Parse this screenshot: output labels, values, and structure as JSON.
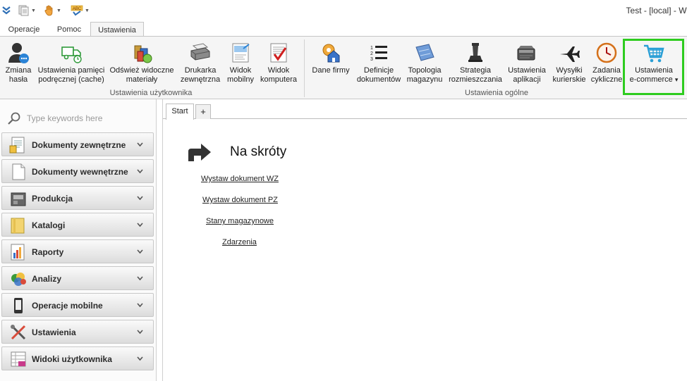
{
  "window": {
    "title": "Test - [local] - We"
  },
  "quick_access": [
    {
      "icon": "double-chevron-down-icon"
    },
    {
      "icon": "document-stack-icon"
    },
    {
      "icon": "hand-icon"
    },
    {
      "icon": "spellcheck-icon",
      "text": "ABC"
    }
  ],
  "tabs": [
    {
      "label": "Operacje"
    },
    {
      "label": "Pomoc"
    },
    {
      "label": "Ustawienia",
      "active": true
    }
  ],
  "ribbon": {
    "groups": [
      {
        "label": "Ustawienia użytkownika"
      },
      {
        "label": "Ustawienia ogólne"
      }
    ],
    "buttons": [
      {
        "label": "Zmiana\nhasła",
        "icon": "user-password-icon"
      },
      {
        "label": "Ustawienia pamięci\npodręcznej (cache)",
        "icon": "cache-truck-icon"
      },
      {
        "label": "Odśwież widoczne\nmateriały",
        "icon": "refresh-materials-icon"
      },
      {
        "label": "Drukarka\nzewnętrzna",
        "icon": "printer-icon"
      },
      {
        "label": "Widok\nmobilny",
        "icon": "mobile-view-icon"
      },
      {
        "label": "Widok\nkomputera",
        "icon": "computer-view-icon"
      },
      {
        "label": "Dane firmy",
        "icon": "company-house-icon"
      },
      {
        "label": "Definicje\ndokumentów",
        "icon": "numbered-list-icon"
      },
      {
        "label": "Topologia\nmagazynu",
        "icon": "warehouse-map-icon"
      },
      {
        "label": "Strategia\nrozmieszczania",
        "icon": "chess-piece-icon"
      },
      {
        "label": "Ustawienia\naplikacji",
        "icon": "app-settings-icon"
      },
      {
        "label": "Wysyłki\nkurierskie",
        "icon": "airplane-icon"
      },
      {
        "label": "Zadania\ncykliczne",
        "icon": "clock-icon"
      },
      {
        "label": "Ustawienia\ne-commerce",
        "icon": "shopping-cart-icon",
        "dropdown": "▾"
      }
    ]
  },
  "sidebar": {
    "search_placeholder": "Type keywords here",
    "items": [
      {
        "label": "Dokumenty zewnętrzne",
        "icon": "external-documents-icon"
      },
      {
        "label": "Dokumenty wewnętrzne",
        "icon": "internal-documents-icon"
      },
      {
        "label": "Produkcja",
        "icon": "production-icon"
      },
      {
        "label": "Katalogi",
        "icon": "catalog-folder-icon"
      },
      {
        "label": "Raporty",
        "icon": "reports-chart-icon"
      },
      {
        "label": "Analizy",
        "icon": "analysis-icon"
      },
      {
        "label": "Operacje mobilne",
        "icon": "mobile-device-icon"
      },
      {
        "label": "Ustawienia",
        "icon": "settings-tools-icon"
      },
      {
        "label": "Widoki użytkownika",
        "icon": "user-views-icon"
      }
    ]
  },
  "main": {
    "doc_tabs": [
      {
        "label": "Start"
      },
      {
        "label": "+"
      }
    ],
    "shortcuts_title": "Na skróty",
    "links": [
      {
        "label": "Wystaw dokument WZ"
      },
      {
        "label": "Wystaw dokument PZ"
      },
      {
        "label": "Stany magazynowe"
      },
      {
        "label": "Zdarzenia"
      }
    ]
  },
  "colors": {
    "highlight": "#2ecc1f",
    "accent_blue": "#2a9fd6"
  }
}
